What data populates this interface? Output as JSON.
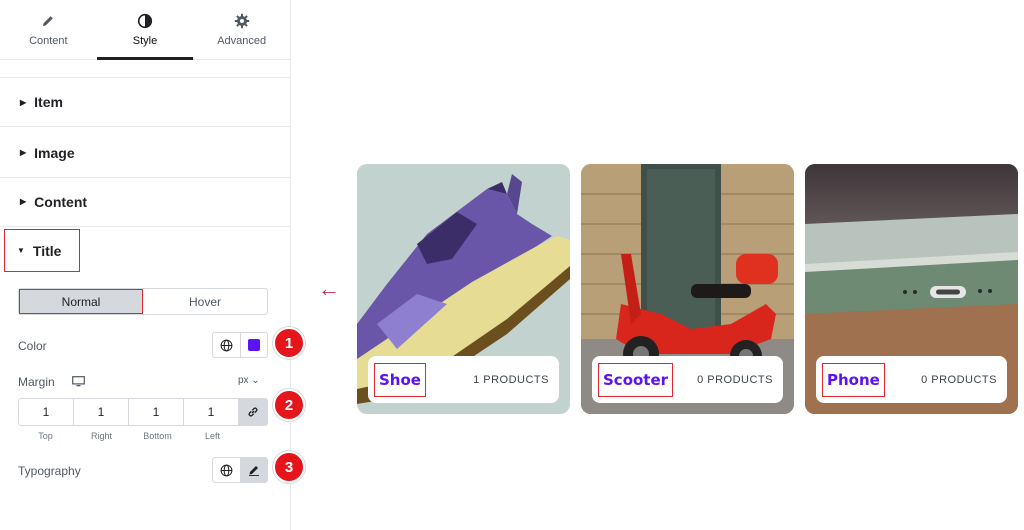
{
  "tabs": [
    {
      "label": "Content",
      "icon": "pencil-icon"
    },
    {
      "label": "Style",
      "icon": "contrast-icon"
    },
    {
      "label": "Advanced",
      "icon": "gear-icon"
    }
  ],
  "sections": {
    "item": "Item",
    "image": "Image",
    "content": "Content",
    "title": "Title"
  },
  "state_toggle": {
    "normal": "Normal",
    "hover": "Hover"
  },
  "controls": {
    "color_label": "Color",
    "color_value": "#5b12f5",
    "margin_label": "Margin",
    "margin_unit": "px ⌄",
    "margin": {
      "top": "1",
      "right": "1",
      "bottom": "1",
      "left": "1"
    },
    "margin_side_labels": {
      "top": "Top",
      "right": "Right",
      "bottom": "Bottom",
      "left": "Left"
    },
    "typography_label": "Typography"
  },
  "badges": [
    "1",
    "2",
    "3"
  ],
  "cards": [
    {
      "name": "Shoe",
      "count": "1 PRODUCTS"
    },
    {
      "name": "Scooter",
      "count": "0 PRODUCTS"
    },
    {
      "name": "Phone",
      "count": "0 PRODUCTS"
    }
  ],
  "colors": {
    "accent": "#5b12f5",
    "highlight": "#e0262e",
    "badge": "#e5151c",
    "arrow": "#c2245f"
  }
}
